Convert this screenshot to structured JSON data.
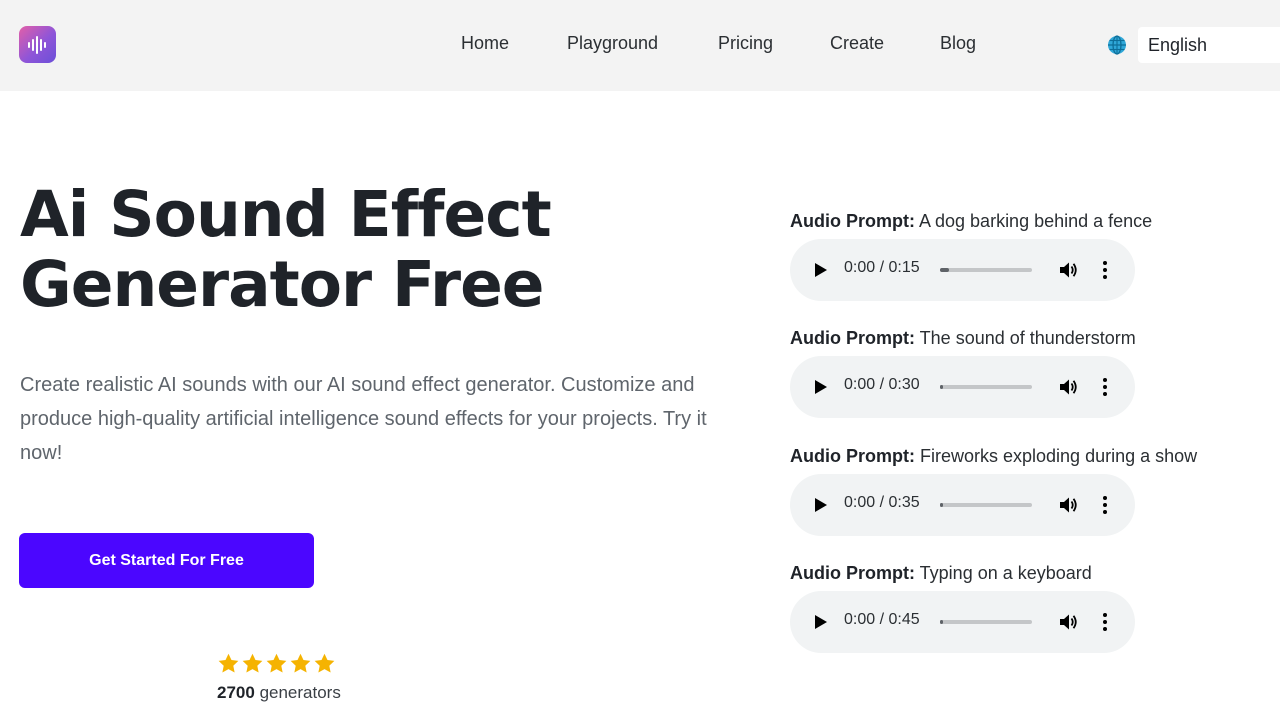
{
  "header": {
    "logo_icon": "waveform-icon",
    "logo_gradient": [
      "#e25fa8",
      "#6b4fd8"
    ],
    "nav": [
      {
        "label": "Home"
      },
      {
        "label": "Playground"
      },
      {
        "label": "Pricing"
      },
      {
        "label": "Create"
      },
      {
        "label": "Blog"
      }
    ],
    "language_icon": "globe-icon",
    "language": "English"
  },
  "hero": {
    "title_line1": "Ai Sound Effect",
    "title_line2": "Generator Free",
    "description": "Create realistic AI sounds with our AI sound effect generator. Customize and produce high-quality artificial intelligence sound effects for your projects. Try it now!",
    "cta_label": "Get Started For Free",
    "cta_color": "#4b06ff",
    "rating_stars": 5,
    "star_color": "#f5b301",
    "rating_count": "2700",
    "rating_suffix": "generators"
  },
  "samples": {
    "prompt_key": "Audio Prompt:",
    "items": [
      {
        "prompt": "A dog barking behind a fence",
        "time": "0:00 / 0:15",
        "progress": 0.1
      },
      {
        "prompt": "The sound of thunderstorm",
        "time": "0:00 / 0:30",
        "progress": 0.03
      },
      {
        "prompt": "Fireworks exploding during a show",
        "time": "0:00 / 0:35",
        "progress": 0.03
      },
      {
        "prompt": "Typing on a keyboard",
        "time": "0:00 / 0:45",
        "progress": 0.03
      }
    ]
  }
}
